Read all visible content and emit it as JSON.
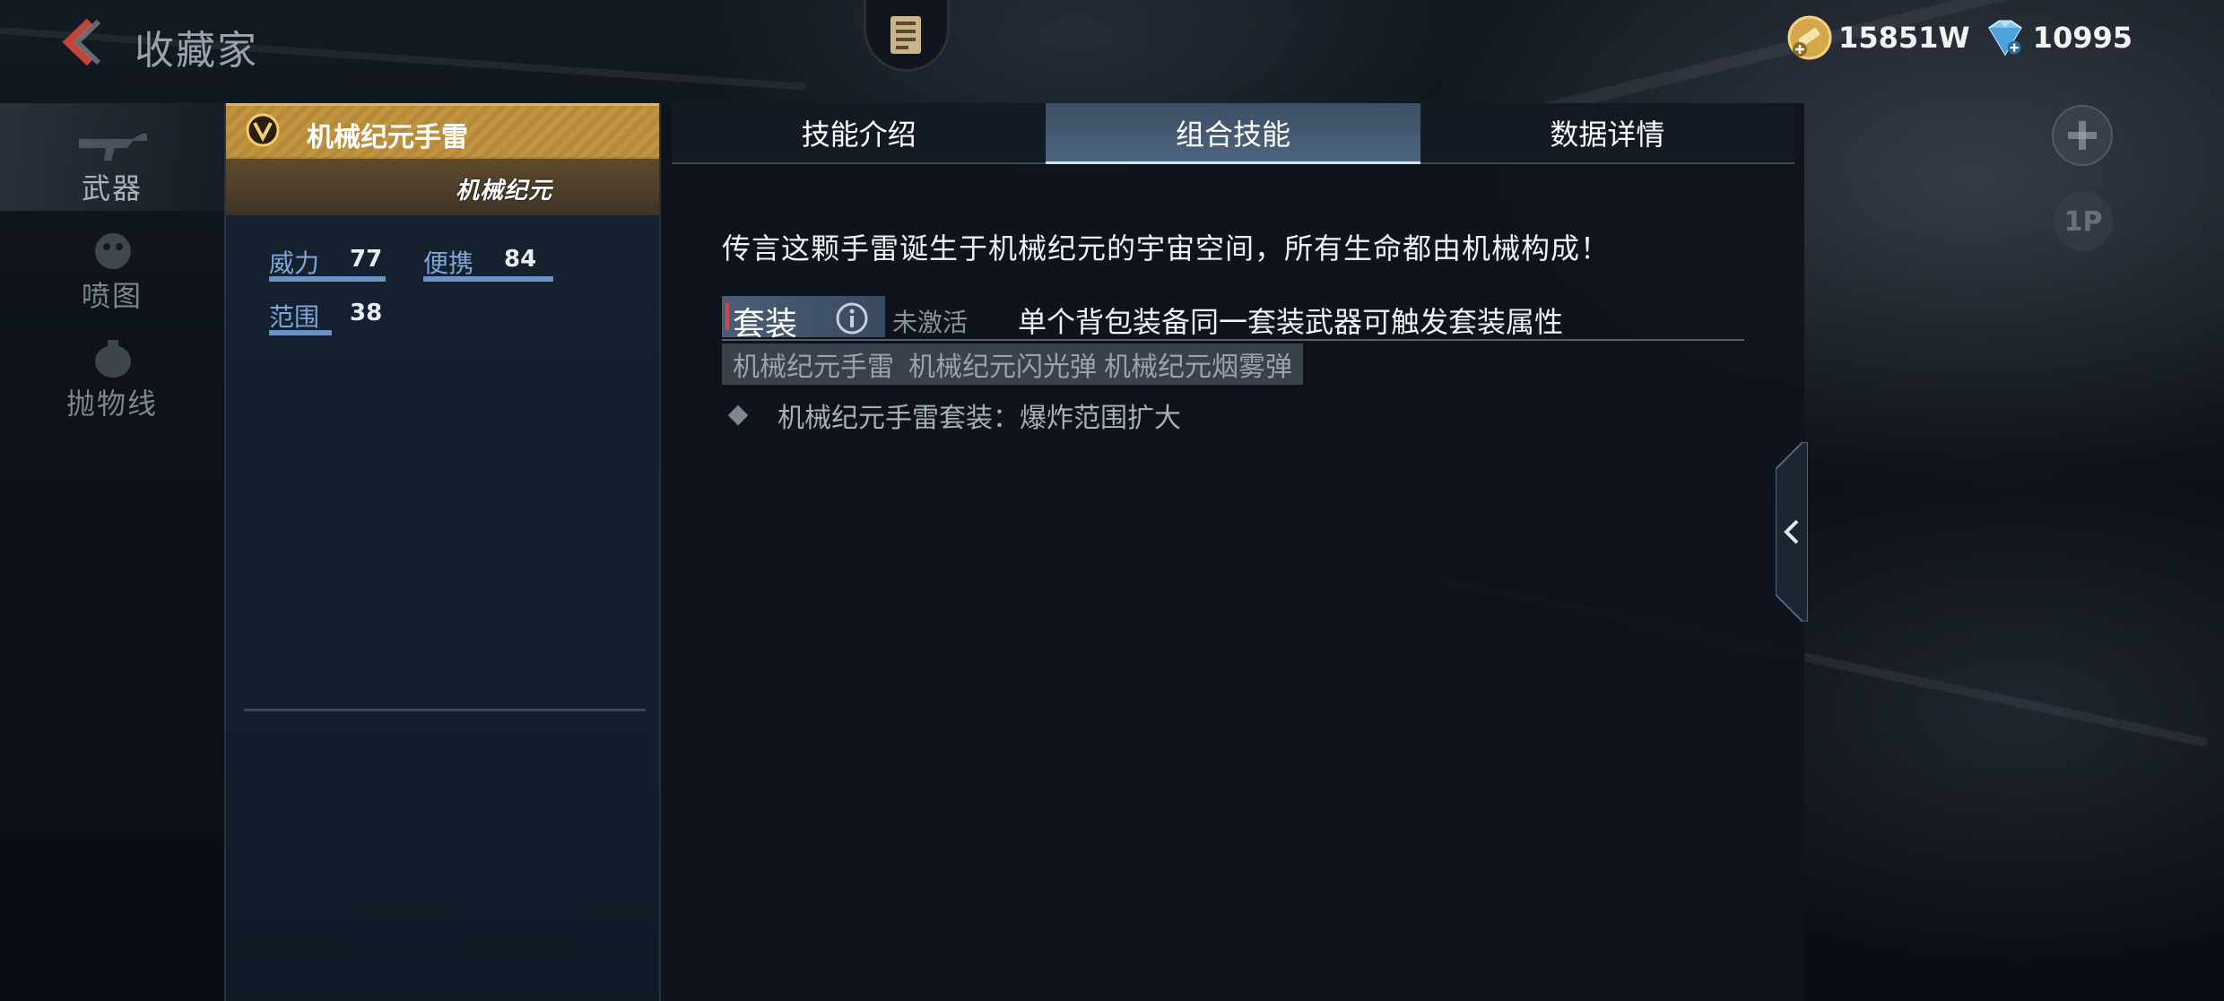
{
  "header": {
    "title": "收藏家",
    "currency": [
      {
        "icon": "gold-coin-icon",
        "value": "15851W"
      },
      {
        "icon": "diamond-icon",
        "value": "10995"
      }
    ]
  },
  "sidebar": {
    "items": [
      {
        "label": "武器",
        "icon": "rifle-icon",
        "active": true
      },
      {
        "label": "喷图",
        "icon": "spray-icon",
        "active": false
      },
      {
        "label": "抛物线",
        "icon": "trajectory-icon",
        "active": false
      }
    ]
  },
  "weapon": {
    "name": "机械纪元手雷",
    "series_logo": "机械纪元",
    "stats": [
      {
        "label": "威力",
        "value": "77"
      },
      {
        "label": "便携",
        "value": "84"
      },
      {
        "label": "范围",
        "value": "38"
      }
    ]
  },
  "tabs": [
    {
      "label": "技能介绍",
      "active": false
    },
    {
      "label": "组合技能",
      "active": true
    },
    {
      "label": "数据详情",
      "active": false
    }
  ],
  "content": {
    "lore": "传言这颗手雷诞生于机械纪元的宇宙空间，所有生命都由机械构成！",
    "set": {
      "title": "套装",
      "status": "未激活",
      "description": "单个背包装备同一套装武器可触发套装属性",
      "items": [
        "机械纪元手雷",
        "机械纪元闪光弹",
        "机械纪元烟雾弹"
      ],
      "bonus": "机械纪元手雷套装：爆炸范围扩大"
    }
  },
  "right_controls": {
    "player_tag": "1P"
  },
  "colors": {
    "gold_header": "#b68a3a",
    "stat_label": "#7fa7d6",
    "active_tab": "#4e6580"
  }
}
